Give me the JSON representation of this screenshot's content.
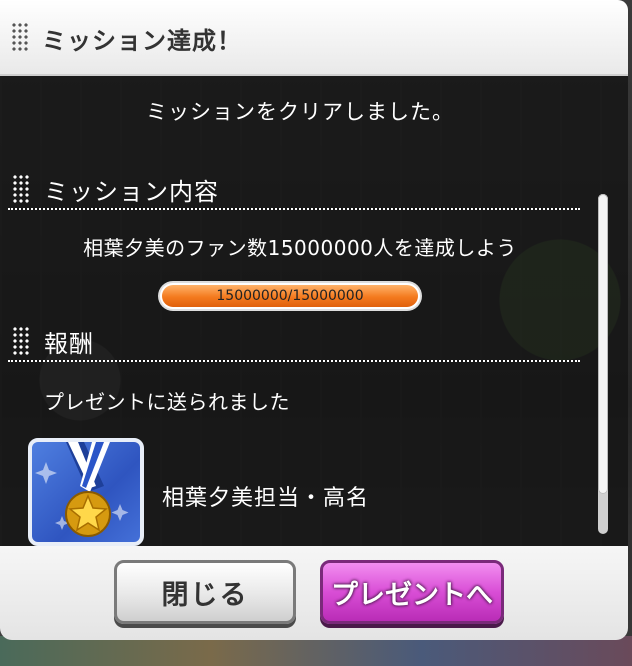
{
  "dialog": {
    "title": "ミッション達成！",
    "cleared_message": "ミッションをクリアしました。"
  },
  "mission": {
    "header": "ミッション内容",
    "description": "相葉夕美のファン数15000000人を達成しよう",
    "progress_text": "15000000/15000000",
    "progress_fraction": 1.0
  },
  "reward": {
    "header": "報酬",
    "sent_message": "プレゼントに送られました",
    "item_name": "相葉夕美担当・高名",
    "icon": "medal-icon"
  },
  "buttons": {
    "close_label": "閉じる",
    "present_label": "プレゼントへ"
  },
  "colors": {
    "progress": "#f47a1e",
    "present_button": "#d94ed6",
    "reward_icon_bg": "#2f55c0"
  }
}
